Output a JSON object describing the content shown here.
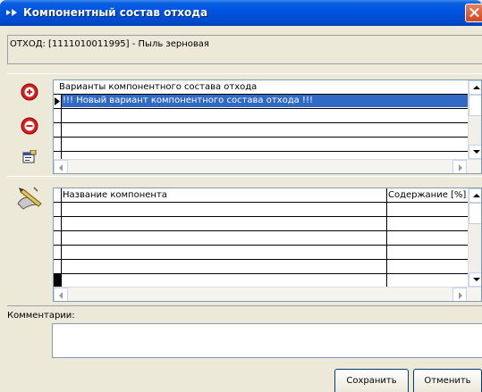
{
  "window": {
    "title": "Компонентный состав отхода"
  },
  "header": {
    "waste_label": "ОТХОД: [1111010011995] - Пыль зерновая"
  },
  "variants_grid": {
    "column_header": "Варианты компонентного состава отхода",
    "rows": [
      "!!! Новый вариант компонентного состава отхода !!!"
    ]
  },
  "components_grid": {
    "columns": [
      "Название компонента",
      "Содержание [%]"
    ]
  },
  "comments": {
    "label": "Комментарии:",
    "value": ""
  },
  "buttons": {
    "save": "Сохранить",
    "cancel": "Отменить"
  },
  "icons": {
    "title": "arrows-icon",
    "add": "add-circle-icon",
    "remove": "remove-circle-icon",
    "properties": "properties-icon",
    "edit": "pen-scroll-icon"
  },
  "colors": {
    "titlebar": "#0054e3",
    "selection": "#316ac5",
    "add_red": "#d81e1e",
    "window_bg": "#ece9d8"
  }
}
